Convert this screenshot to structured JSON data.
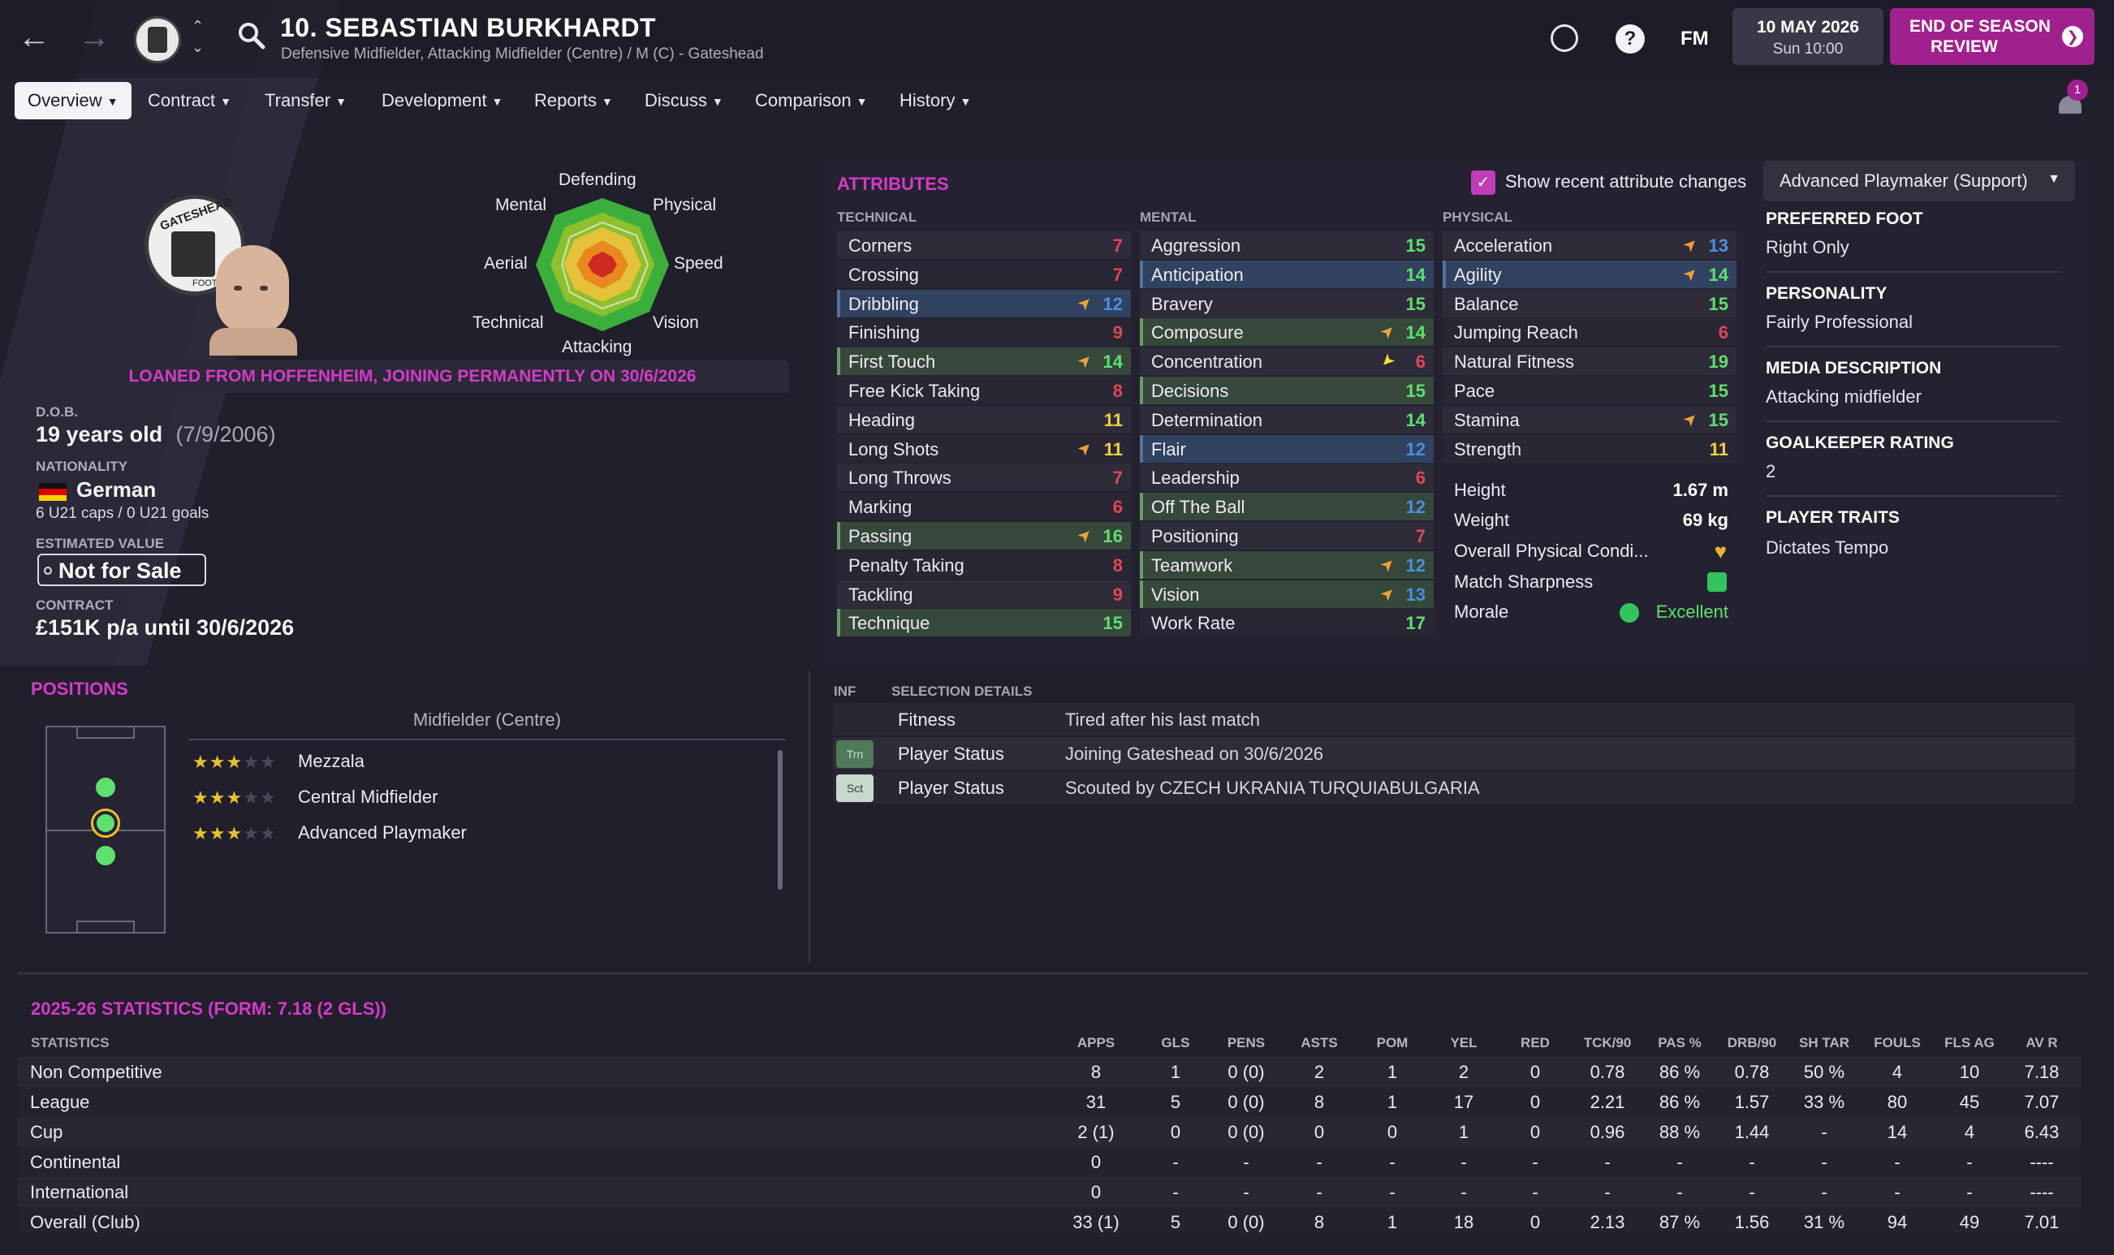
{
  "header": {
    "player_name": "10. SEBASTIAN BURKHARDT",
    "player_subtitle": "Defensive Midfielder, Attacking Midfielder (Centre) / M (C) - Gateshead",
    "date": "10 MAY 2026",
    "time": "Sun 10:00",
    "fm_label": "FM",
    "eos_label_1": "END OF SEASON",
    "eos_label_2": "REVIEW",
    "notification_count": "1"
  },
  "tabs": [
    {
      "label": "Overview"
    },
    {
      "label": "Contract"
    },
    {
      "label": "Transfer"
    },
    {
      "label": "Development"
    },
    {
      "label": "Reports"
    },
    {
      "label": "Discuss"
    },
    {
      "label": "Comparison"
    },
    {
      "label": "History"
    }
  ],
  "profile": {
    "club_badge_text": "GATESHEAD",
    "club_badge_sub": "FOOT",
    "loan_banner": "LOANED FROM HOFFENHEIM, JOINING PERMANENTLY ON 30/6/2026",
    "dob_label": "D.O.B.",
    "age": "19 years old",
    "dob": "(7/9/2006)",
    "nationality_label": "NATIONALITY",
    "nationality": "German",
    "caps": "6 U21 caps / 0 U21 goals",
    "value_label": "ESTIMATED VALUE",
    "value": "Not for Sale",
    "contract_label": "CONTRACT",
    "contract": "£151K p/a until 30/6/2026"
  },
  "radar": {
    "labels": {
      "defending": "Defending",
      "physical": "Physical",
      "speed": "Speed",
      "vision": "Vision",
      "attacking": "Attacking",
      "technical": "Technical",
      "aerial": "Aerial",
      "mental": "Mental"
    }
  },
  "attributes": {
    "title": "ATTRIBUTES",
    "show_changes_label": "Show recent attribute changes",
    "role": "Advanced Playmaker (Support)",
    "technical_header": "TECHNICAL",
    "mental_header": "MENTAL",
    "physical_header": "PHYSICAL",
    "technical": [
      {
        "name": "Corners",
        "value": "7",
        "arrow": ""
      },
      {
        "name": "Crossing",
        "value": "7",
        "arrow": ""
      },
      {
        "name": "Dribbling",
        "value": "12",
        "arrow": "up"
      },
      {
        "name": "Finishing",
        "value": "9",
        "arrow": ""
      },
      {
        "name": "First Touch",
        "value": "14",
        "arrow": "up"
      },
      {
        "name": "Free Kick Taking",
        "value": "8",
        "arrow": ""
      },
      {
        "name": "Heading",
        "value": "11",
        "arrow": ""
      },
      {
        "name": "Long Shots",
        "value": "11",
        "arrow": "up"
      },
      {
        "name": "Long Throws",
        "value": "7",
        "arrow": ""
      },
      {
        "name": "Marking",
        "value": "6",
        "arrow": ""
      },
      {
        "name": "Passing",
        "value": "16",
        "arrow": "up"
      },
      {
        "name": "Penalty Taking",
        "value": "8",
        "arrow": ""
      },
      {
        "name": "Tackling",
        "value": "9",
        "arrow": ""
      },
      {
        "name": "Technique",
        "value": "15",
        "arrow": ""
      }
    ],
    "mental": [
      {
        "name": "Aggression",
        "value": "15",
        "arrow": ""
      },
      {
        "name": "Anticipation",
        "value": "14",
        "arrow": ""
      },
      {
        "name": "Bravery",
        "value": "15",
        "arrow": ""
      },
      {
        "name": "Composure",
        "value": "14",
        "arrow": "up"
      },
      {
        "name": "Concentration",
        "value": "6",
        "arrow": "down"
      },
      {
        "name": "Decisions",
        "value": "15",
        "arrow": ""
      },
      {
        "name": "Determination",
        "value": "14",
        "arrow": ""
      },
      {
        "name": "Flair",
        "value": "12",
        "arrow": ""
      },
      {
        "name": "Leadership",
        "value": "6",
        "arrow": ""
      },
      {
        "name": "Off The Ball",
        "value": "12",
        "arrow": ""
      },
      {
        "name": "Positioning",
        "value": "7",
        "arrow": ""
      },
      {
        "name": "Teamwork",
        "value": "12",
        "arrow": "up"
      },
      {
        "name": "Vision",
        "value": "13",
        "arrow": "up"
      },
      {
        "name": "Work Rate",
        "value": "17",
        "arrow": ""
      }
    ],
    "physical": [
      {
        "name": "Acceleration",
        "value": "13",
        "arrow": "up"
      },
      {
        "name": "Agility",
        "value": "14",
        "arrow": "up"
      },
      {
        "name": "Balance",
        "value": "15",
        "arrow": ""
      },
      {
        "name": "Jumping Reach",
        "value": "6",
        "arrow": ""
      },
      {
        "name": "Natural Fitness",
        "value": "19",
        "arrow": ""
      },
      {
        "name": "Pace",
        "value": "15",
        "arrow": ""
      },
      {
        "name": "Stamina",
        "value": "15",
        "arrow": "up"
      },
      {
        "name": "Strength",
        "value": "11",
        "arrow": ""
      }
    ],
    "height_label": "Height",
    "height": "1.67 m",
    "weight_label": "Weight",
    "weight": "69 kg",
    "condition_label": "Overall Physical Condi...",
    "sharpness_label": "Match Sharpness",
    "morale_label": "Morale",
    "morale": "Excellent"
  },
  "right_panel": {
    "foot_label": "PREFERRED FOOT",
    "foot": "Right Only",
    "personality_label": "PERSONALITY",
    "personality": "Fairly Professional",
    "media_label": "MEDIA DESCRIPTION",
    "media": "Attacking midfielder",
    "gk_label": "GOALKEEPER RATING",
    "gk": "2",
    "traits_label": "PLAYER TRAITS",
    "traits": "Dictates Tempo"
  },
  "positions": {
    "title": "POSITIONS",
    "group": "Midfielder (Centre)",
    "roles": [
      {
        "label": "Mezzala",
        "stars": 3
      },
      {
        "label": "Central Midfielder",
        "stars": 3
      },
      {
        "label": "Advanced Playmaker",
        "stars": 3
      }
    ]
  },
  "selection": {
    "inf_header": "INF",
    "details_header": "SELECTION DETAILS",
    "rows": [
      {
        "badge": "",
        "key": "Fitness",
        "value": "Tired after his last match"
      },
      {
        "badge": "Trn",
        "key": "Player Status",
        "value": "Joining Gateshead on 30/6/2026"
      },
      {
        "badge": "Sct",
        "key": "Player Status",
        "value": "Scouted by CZECH UKRANIA TURQUIABULGARIA"
      }
    ]
  },
  "stats": {
    "title": "2025-26 STATISTICS (FORM: 7.18 (2 GLS))",
    "label_header": "STATISTICS",
    "columns": [
      "APPS",
      "GLS",
      "PENS",
      "ASTS",
      "POM",
      "YEL",
      "RED",
      "TCK/90",
      "PAS %",
      "DRB/90",
      "SH TAR",
      "FOULS",
      "FLS AG",
      "AV R"
    ],
    "rows": [
      {
        "label": "Non Competitive",
        "values": [
          "8",
          "1",
          "0 (0)",
          "2",
          "1",
          "2",
          "0",
          "0.78",
          "86 %",
          "0.78",
          "50 %",
          "4",
          "10",
          "7.18"
        ]
      },
      {
        "label": "League",
        "values": [
          "31",
          "5",
          "0 (0)",
          "8",
          "1",
          "17",
          "0",
          "2.21",
          "86 %",
          "1.57",
          "33 %",
          "80",
          "45",
          "7.07"
        ]
      },
      {
        "label": "Cup",
        "values": [
          "2 (1)",
          "0",
          "0 (0)",
          "0",
          "0",
          "1",
          "0",
          "0.96",
          "88 %",
          "1.44",
          "-",
          "14",
          "4",
          "6.43"
        ]
      },
      {
        "label": "Continental",
        "values": [
          "0",
          "-",
          "-",
          "-",
          "-",
          "-",
          "-",
          "-",
          "-",
          "-",
          "-",
          "-",
          "-",
          "----"
        ]
      },
      {
        "label": "International",
        "values": [
          "0",
          "-",
          "-",
          "-",
          "-",
          "-",
          "-",
          "-",
          "-",
          "-",
          "-",
          "-",
          "-",
          "----"
        ]
      },
      {
        "label": "Overall (Club)",
        "values": [
          "33 (1)",
          "5",
          "0 (0)",
          "8",
          "1",
          "18",
          "0",
          "2.13",
          "87 %",
          "1.56",
          "31 %",
          "94",
          "49",
          "7.01"
        ]
      }
    ]
  },
  "colors": {
    "accent": "#d33bc8",
    "eos_button": "#a0218e",
    "value_red": "#e0465a",
    "value_blue": "#4a8fe0",
    "value_green": "#5fe06e",
    "value_yellow": "#f0d040",
    "arrow_orange": "#f0a038",
    "arrow_yellow": "#f0e030"
  }
}
